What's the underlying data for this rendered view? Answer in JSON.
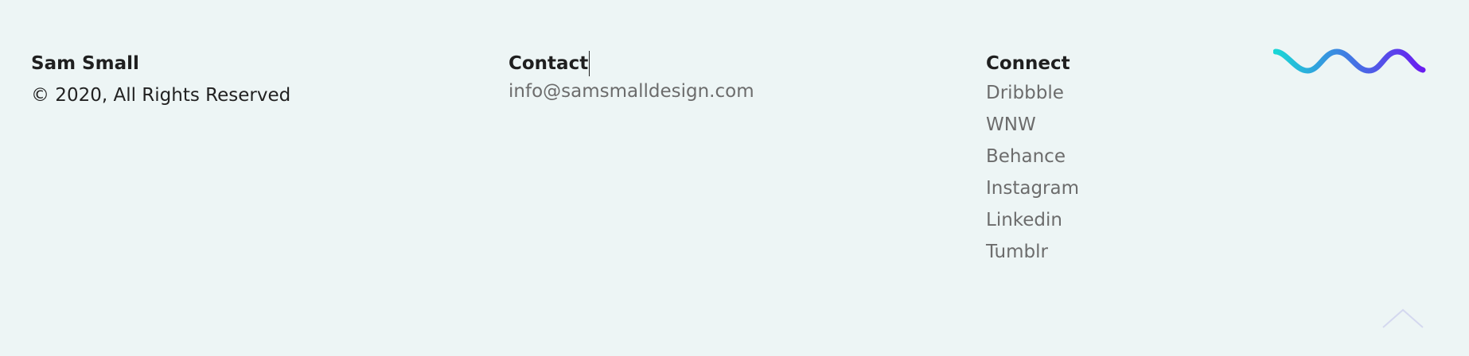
{
  "brand": {
    "name": "Sam Small",
    "copyright": "© 2020, All Rights Reserved"
  },
  "contact": {
    "heading": "Contact",
    "email": "info@samsmalldesign.com"
  },
  "connect": {
    "heading": "Connect",
    "links": [
      "Dribbble",
      "WNW",
      "Behance",
      "Instagram",
      "Linkedin",
      "Tumblr"
    ]
  },
  "colors": {
    "background": "#edf5f5",
    "wave_start": "#1ad6d6",
    "wave_end": "#6a1cf0"
  },
  "icons": {
    "logo": "wave-logo-icon",
    "back_to_top": "chevron-up-icon"
  }
}
